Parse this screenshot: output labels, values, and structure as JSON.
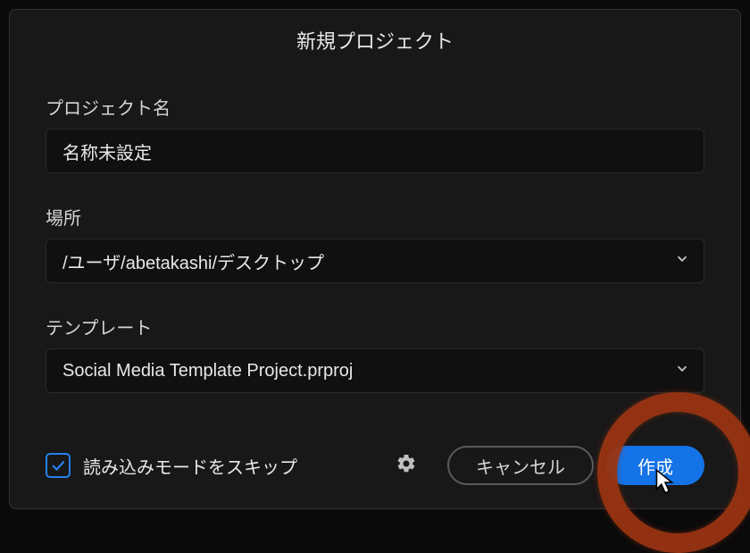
{
  "dialog": {
    "title": "新規プロジェクト"
  },
  "fields": {
    "projectName": {
      "label": "プロジェクト名",
      "value": "名称未設定"
    },
    "location": {
      "label": "場所",
      "value": "/ユーザ/abetakashi/デスクトップ"
    },
    "template": {
      "label": "テンプレート",
      "value": "Social Media Template Project.prproj"
    }
  },
  "footer": {
    "skipImport": {
      "label": "読み込みモードをスキップ",
      "checked": true
    },
    "cancel": "キャンセル",
    "create": "作成"
  }
}
